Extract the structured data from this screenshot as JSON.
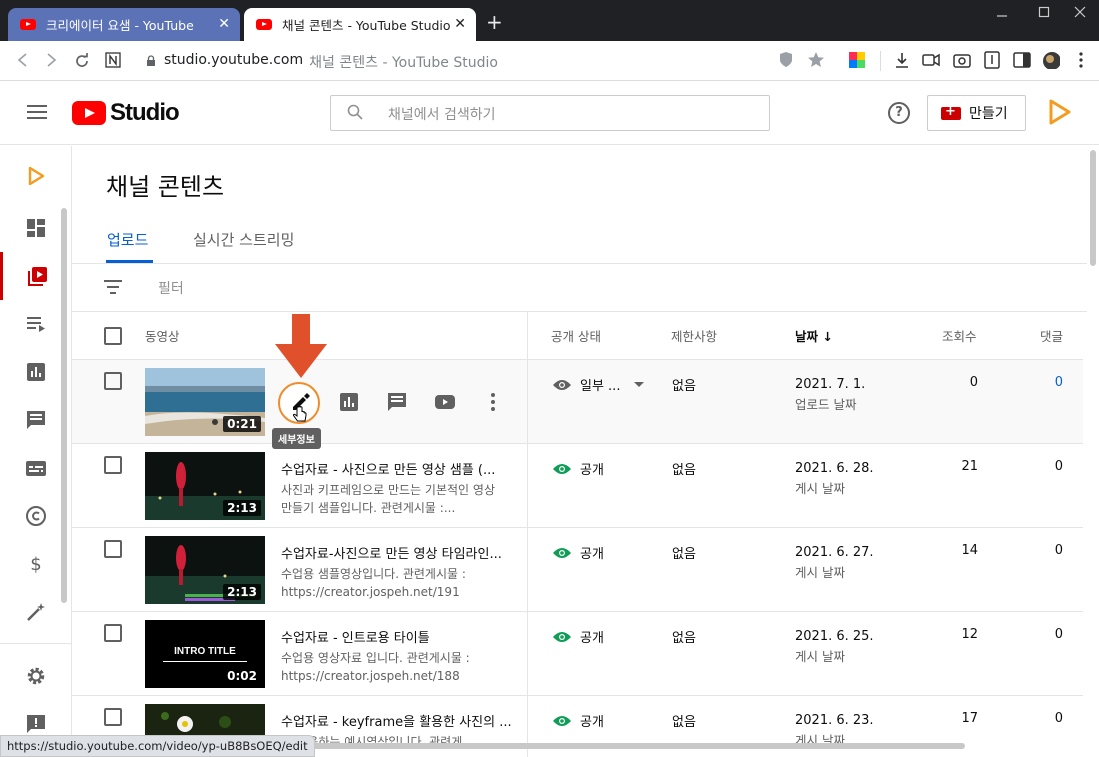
{
  "browser": {
    "tabs": [
      {
        "title": "크리에이터 요샘 - YouTube"
      },
      {
        "title": "채널 콘텐츠 - YouTube Studio"
      }
    ],
    "close_glyph": "✕",
    "new_tab_glyph": "+",
    "url_host": "studio.youtube.com",
    "url_title": "채널 콘텐츠 - YouTube Studio",
    "status_url": "https://studio.youtube.com/video/yp-uB8BsOEQ/edit"
  },
  "header": {
    "logo_text": "Studio",
    "search_placeholder": "채널에서 검색하기",
    "help_glyph": "?",
    "create_label": "만들기"
  },
  "page": {
    "title": "채널 콘텐츠",
    "tabs": [
      "업로드",
      "실시간 스트리밍"
    ],
    "filter_label": "필터"
  },
  "table": {
    "headers": {
      "video": "동영상",
      "visibility": "공개 상태",
      "restrictions": "제한사항",
      "date": "날짜",
      "date_sort": "↓",
      "views": "조회수",
      "comments": "댓글"
    },
    "rows": [
      {
        "title": "",
        "desc": "",
        "duration": "0:21",
        "visibility": "일부 ...",
        "restrictions": "없음",
        "date": "2021. 7. 1.",
        "date_type": "업로드 날짜",
        "views": "0",
        "comments": "0"
      },
      {
        "title": "수업자료 - 사진으로 만든 영상 샘플 (...",
        "desc": "사진과 키프레임으로 만드는 기본적인 영상만들기 샘플입니다. 관련게시물 :...",
        "duration": "2:13",
        "visibility": "공개",
        "restrictions": "없음",
        "date": "2021. 6. 28.",
        "date_type": "게시 날짜",
        "views": "21",
        "comments": "0"
      },
      {
        "title": "수업자료-사진으로 만든 영상 타임라인...",
        "desc": "수업용 샘플영상입니다. 관련게시물 : https://creator.jospeh.net/191",
        "duration": "2:13",
        "visibility": "공개",
        "restrictions": "없음",
        "date": "2021. 6. 27.",
        "date_type": "게시 날짜",
        "views": "14",
        "comments": "0"
      },
      {
        "title": "수업자료 - 인트로용 타이틀",
        "desc": "수업용 영상자료 입니다. 관련게시물 : https://creator.jospeh.net/188",
        "duration": "0:02",
        "visibility": "공개",
        "restrictions": "없음",
        "date": "2021. 6. 25.",
        "date_type": "게시 날짜",
        "views": "12",
        "comments": "0",
        "thumb_text": "INTRO TITLE"
      },
      {
        "title": "수업자료 - keyframe을 활용한 사진의 ...",
        "desc": "... 활용하는 예시영상입니다. 관련게...",
        "duration": "",
        "visibility": "공개",
        "restrictions": "없음",
        "date": "2021. 6. 23.",
        "date_type": "게시 날짜",
        "views": "17",
        "comments": "0"
      }
    ]
  },
  "tooltip": "세부정보",
  "colors": {
    "accent": "#065fd4",
    "brand_red": "#ff0000",
    "visible_green": "#0f9d58",
    "arrow": "#e0502b"
  }
}
